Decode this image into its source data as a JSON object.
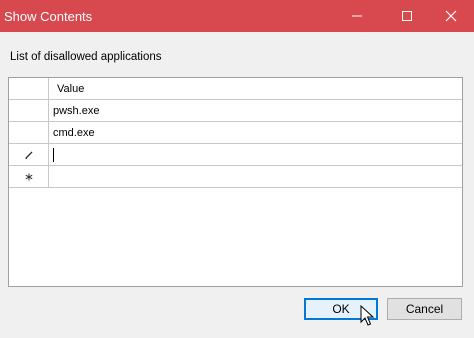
{
  "window": {
    "title": "Show Contents",
    "title_bar_color": "#d8484f",
    "controls": {
      "minimize_icon": "minimize-icon",
      "maximize_icon": "maximize-icon",
      "close_icon": "close-icon"
    }
  },
  "instruction": "List of disallowed applications",
  "table": {
    "column_header": "Value",
    "rows": [
      {
        "value": "pwsh.exe",
        "row_icon": ""
      },
      {
        "value": "cmd.exe",
        "row_icon": ""
      },
      {
        "value": "",
        "row_icon": "pencil-edit-icon",
        "editing": true
      },
      {
        "value": "",
        "row_icon": "new-row-asterisk-icon"
      }
    ]
  },
  "buttons": {
    "ok": "OK",
    "cancel": "Cancel"
  },
  "colors": {
    "accent": "#0078d7"
  }
}
